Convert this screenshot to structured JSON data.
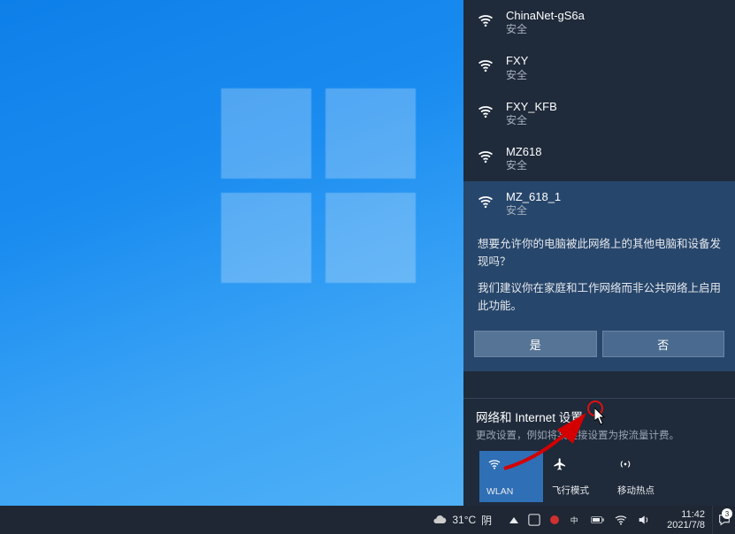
{
  "networks": [
    {
      "name": "ChinaNet-gS6a",
      "status": "安全"
    },
    {
      "name": "FXY",
      "status": "安全"
    },
    {
      "name": "FXY_KFB",
      "status": "安全"
    },
    {
      "name": "MZ618",
      "status": "安全"
    }
  ],
  "selected_network": {
    "name": "MZ_618_1",
    "status": "安全",
    "prompt_line1": "想要允许你的电脑被此网络上的其他电脑和设备发现吗？",
    "prompt_advice": "我们建议你在家庭和工作网络而非公共网络上启用此功能。",
    "yes_label": "是",
    "no_label": "否"
  },
  "settings": {
    "title": "网络和 Internet 设置",
    "subtitle": "更改设置，例如将某连接设置为按流量计费。"
  },
  "tiles": {
    "wlan": "WLAN",
    "airplane": "飞行模式",
    "hotspot": "移动热点"
  },
  "taskbar": {
    "weather_temp": "31°C",
    "weather_desc": "阴",
    "time": "11:42",
    "date": "2021/7/8",
    "notif_count": "3"
  }
}
